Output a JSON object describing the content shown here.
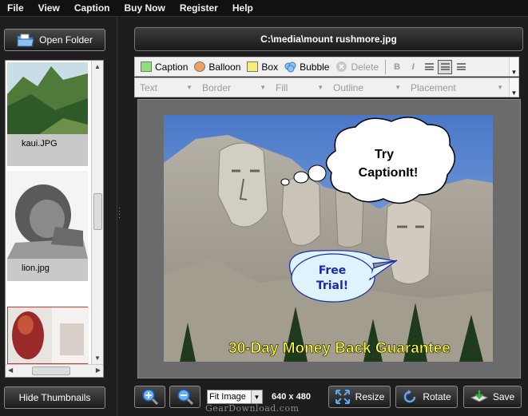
{
  "menu": [
    "File",
    "View",
    "Caption",
    "Buy Now",
    "Register",
    "Help"
  ],
  "left_panel": {
    "open_folder_label": "Open Folder",
    "hide_thumbnails_label": "Hide Thumbnails",
    "thumbnails": [
      {
        "caption": "kaui.JPG"
      },
      {
        "caption": "lion.jpg"
      },
      {
        "caption": ""
      }
    ]
  },
  "file_path": "C:\\media\\mount rushmore.jpg",
  "caption_toolbar": {
    "caption": "Caption",
    "balloon": "Balloon",
    "box": "Box",
    "bubble": "Bubble",
    "delete": "Delete",
    "bold": "B",
    "italic": "I"
  },
  "style_toolbar": {
    "text": "Text",
    "border": "Border",
    "fill": "Fill",
    "outline": "Outline",
    "placement": "Placement"
  },
  "image_captions": {
    "thought_bubble": "Try CaptionIt!",
    "speech_balloon": "Free Trial!",
    "bottom_caption": "30-Day Money Back Guarantee"
  },
  "bottom_bar": {
    "fit_option": "Fit Image",
    "dimensions": "640 x 480",
    "resize": "Resize",
    "rotate": "Rotate",
    "save": "Save"
  },
  "watermark": "GearDownload.com",
  "colors": {
    "caption_swatch": "#8fe07a",
    "balloon_swatch": "#f0a060",
    "box_swatch": "#f5ef7a",
    "caption_text": "#ffff33",
    "speech_fill": "#dff3ff",
    "speech_text": "#1a2aa8"
  }
}
